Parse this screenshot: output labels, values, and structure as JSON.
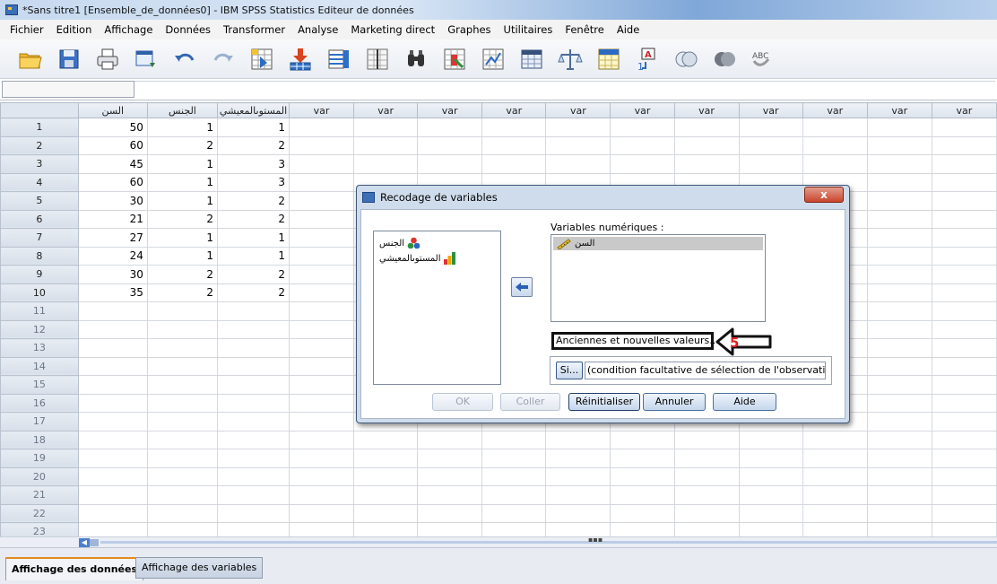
{
  "window": {
    "title": "*Sans titre1 [Ensemble_de_données0] - IBM SPSS Statistics Editeur de données"
  },
  "menu": {
    "items": [
      "Fichier",
      "Edition",
      "Affichage",
      "Données",
      "Transformer",
      "Analyse",
      "Marketing direct",
      "Graphes",
      "Utilitaires",
      "Fenêtre",
      "Aide"
    ]
  },
  "toolbar": {
    "icons": [
      "open-folder-icon",
      "save-icon",
      "print-icon",
      "dialog-recall-icon",
      "undo-icon",
      "redo-icon",
      "goto-case-icon",
      "goto-variable-icon",
      "variables-icon",
      "find-icon",
      "insert-cases-icon",
      "insert-variable-icon",
      "split-file-icon",
      "weight-cases-icon",
      "select-cases-icon",
      "value-labels-icon",
      "use-sets-icon",
      "show-all-variables-icon",
      "spell-check-icon"
    ]
  },
  "grid": {
    "columns": [
      "السن",
      "الجنس",
      "المستوىالمعيشي",
      "var",
      "var",
      "var",
      "var",
      "var",
      "var",
      "var",
      "var",
      "var",
      "var",
      "var"
    ],
    "rows": [
      {
        "num": "1",
        "cells": [
          "50",
          "1",
          "1"
        ]
      },
      {
        "num": "2",
        "cells": [
          "60",
          "2",
          "2"
        ]
      },
      {
        "num": "3",
        "cells": [
          "45",
          "1",
          "3"
        ]
      },
      {
        "num": "4",
        "cells": [
          "60",
          "1",
          "3"
        ]
      },
      {
        "num": "5",
        "cells": [
          "30",
          "1",
          "2"
        ]
      },
      {
        "num": "6",
        "cells": [
          "21",
          "2",
          "2"
        ]
      },
      {
        "num": "7",
        "cells": [
          "27",
          "1",
          "1"
        ]
      },
      {
        "num": "8",
        "cells": [
          "24",
          "1",
          "1"
        ]
      },
      {
        "num": "9",
        "cells": [
          "30",
          "2",
          "2"
        ]
      },
      {
        "num": "10",
        "cells": [
          "35",
          "2",
          "2"
        ]
      },
      {
        "num": "11",
        "cells": [
          "",
          "",
          ""
        ]
      },
      {
        "num": "12",
        "cells": [
          "",
          "",
          ""
        ]
      },
      {
        "num": "13",
        "cells": [
          "",
          "",
          ""
        ]
      },
      {
        "num": "14",
        "cells": [
          "",
          "",
          ""
        ]
      },
      {
        "num": "15",
        "cells": [
          "",
          "",
          ""
        ]
      },
      {
        "num": "16",
        "cells": [
          "",
          "",
          ""
        ]
      },
      {
        "num": "17",
        "cells": [
          "",
          "",
          ""
        ]
      },
      {
        "num": "18",
        "cells": [
          "",
          "",
          ""
        ]
      },
      {
        "num": "19",
        "cells": [
          "",
          "",
          ""
        ]
      },
      {
        "num": "20",
        "cells": [
          "",
          "",
          ""
        ]
      },
      {
        "num": "21",
        "cells": [
          "",
          "",
          ""
        ]
      },
      {
        "num": "22",
        "cells": [
          "",
          "",
          ""
        ]
      },
      {
        "num": "23",
        "cells": [
          "",
          "",
          ""
        ]
      }
    ]
  },
  "tabs": {
    "data_view": "Affichage des données",
    "variable_view": "Affichage des variables"
  },
  "dialog": {
    "title": "Recodage de variables",
    "close_label": "x",
    "source_vars": [
      {
        "label": "الجنس",
        "icon": "nominal-icon"
      },
      {
        "label": "المستوىالمعيشي",
        "icon": "ordinal-icon"
      }
    ],
    "numeric_label": "Variables numériques :",
    "numeric_vars": [
      {
        "label": "السن",
        "icon": "scale-icon"
      }
    ],
    "old_new_button": "Anciennes et nouvelles valeurs...",
    "annotation_number": "5",
    "if_button": "Si...",
    "if_text": "(condition facultative de sélection de l'observation)",
    "buttons": {
      "ok": "OK",
      "paste": "Coller",
      "reset": "Réinitialiser",
      "cancel": "Annuler",
      "help": "Aide"
    }
  }
}
